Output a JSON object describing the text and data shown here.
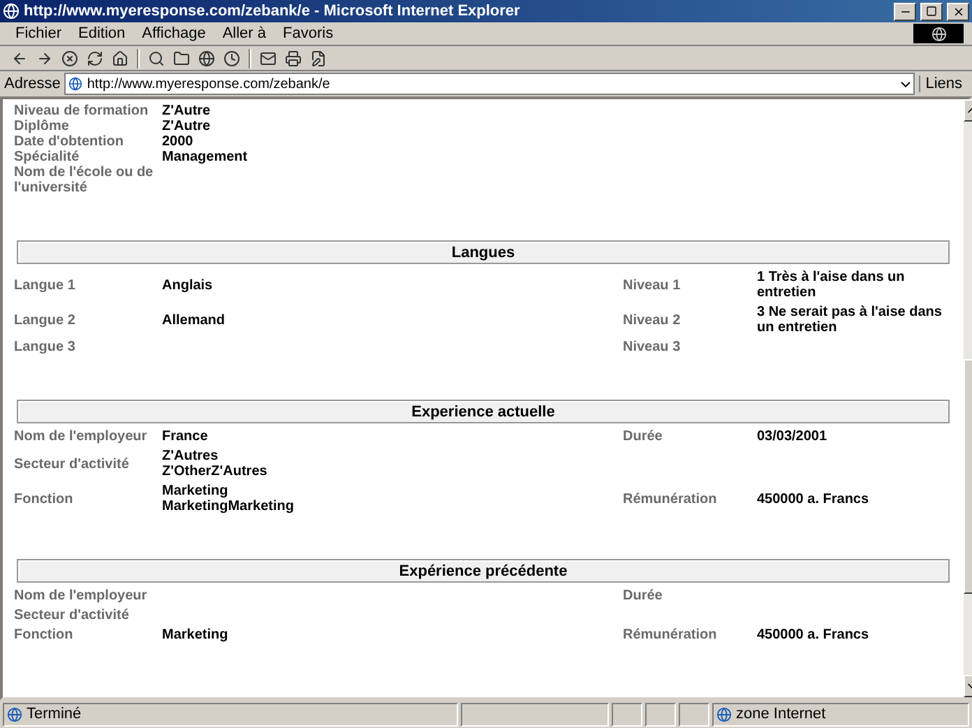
{
  "window": {
    "title": "http://www.myeresponse.com/zebank/e - Microsoft Internet Explorer"
  },
  "menu": [
    "Fichier",
    "Edition",
    "Affichage",
    "Aller à",
    "Favoris"
  ],
  "address": {
    "label": "Adresse",
    "value": "http://www.myeresponse.com/zebank/e",
    "links": "Liens"
  },
  "education": [
    {
      "label": "Niveau de formation",
      "value": "Z'Autre"
    },
    {
      "label": "Diplôme",
      "value": "Z'Autre"
    },
    {
      "label": "Date d'obtention",
      "value": "2000"
    },
    {
      "label": "Spécialité",
      "value": "Management"
    },
    {
      "label": "Nom de l'école ou de l'université"
    }
  ],
  "sections": [
    {
      "title": "Langues",
      "rows": [
        {
          "label": "Langue 1",
          "value": "Anglais",
          "label2": "Niveau 1",
          "value2": "1 Très à l'aise dans un entretien"
        },
        {
          "label": "Langue 2",
          "value": "Allemand",
          "label2": "Niveau 2",
          "value2": "3 Ne serait pas à l'aise dans un entretien"
        },
        {
          "label": "Langue 3",
          "label2": "Niveau 3"
        }
      ]
    },
    {
      "title": "Experience actuelle",
      "rows": [
        {
          "label": "Nom de l'employeur",
          "value": "France",
          "label2": "Durée",
          "value2": "03/03/2001"
        },
        {
          "label": "Secteur d'activité",
          "value": "Z'Autres\nZ'OtherZ'Autres"
        },
        {
          "label": "Fonction",
          "value": "Marketing\nMarketingMarketing",
          "label2": "Rémunération",
          "value2": "450000 a. Francs"
        }
      ]
    },
    {
      "title": "Expérience précédente",
      "rows": [
        {
          "label": "Nom de l'employeur",
          "label2": "Durée"
        },
        {
          "label": "Secteur d'activité"
        },
        {
          "label": "Fonction",
          "value": "Marketing",
          "label2": "Rémunération",
          "value2": "450000 a. Francs"
        }
      ]
    }
  ],
  "status": {
    "text": "Terminé",
    "zone": "zone Internet"
  }
}
